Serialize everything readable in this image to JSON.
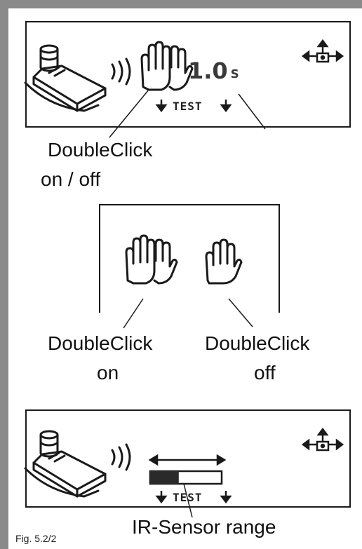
{
  "panel1": {
    "time_value": "1.0",
    "time_unit": "s",
    "test_label": "TEST",
    "callout_line1": "DoubleClick",
    "callout_line2": "on / off"
  },
  "panel2": {
    "left_line1": "DoubleClick",
    "left_line2": "on",
    "right_line1": "DoubleClick",
    "right_line2": "off"
  },
  "panel3": {
    "test_label": "TEST",
    "range_fraction": 0.4,
    "callout": "IR-Sensor range"
  },
  "figure_label": "Fig. 5.2/2",
  "icons": [
    "dispenser-hand-icon",
    "double-hand-icon",
    "single-hand-icon",
    "menu-navigation-icon",
    "arrow-down-icon",
    "double-arrow-icon"
  ],
  "colors": {
    "frame": "#8a8a8a",
    "ink": "#1a1a1a",
    "bar_fill": "#2a2a2a"
  }
}
